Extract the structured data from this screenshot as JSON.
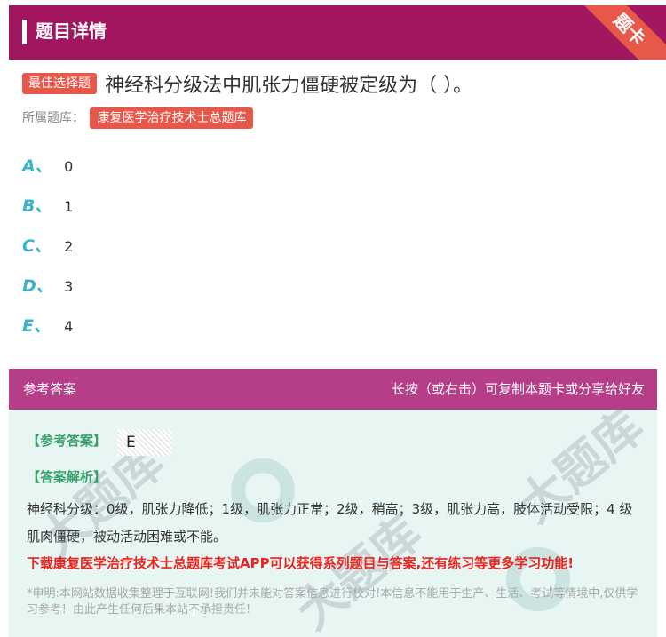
{
  "header": {
    "title": "题目详情",
    "corner_label": "题卡"
  },
  "question": {
    "type_label": "最佳选择题",
    "text": "神经科分级法中肌张力僵硬被定级为（ ）。",
    "bank_label": "所属题库：",
    "bank_name": "康复医学治疗技术士总题库"
  },
  "options": [
    {
      "letter": "A、",
      "text": "0"
    },
    {
      "letter": "B、",
      "text": "1"
    },
    {
      "letter": "C、",
      "text": "2"
    },
    {
      "letter": "D、",
      "text": "3"
    },
    {
      "letter": "E、",
      "text": "4"
    }
  ],
  "answer": {
    "head_left": "参考答案",
    "head_right": "长按（或右击）可复制本题卡或分享给好友",
    "ref_label": "【参考答案】",
    "ref_value": "E",
    "analysis_label": "【答案解析】",
    "analysis_text": "神经科分级：0级，肌张力降低；1级，肌张力正常；2级，稍高；3级，肌张力高，肢体活动受限；4 级肌肉僵硬，被动活动困难或不能。",
    "promo": "下载康复医学治疗技术士总题库考试APP可以获得系列题目与答案,还有练习等更多学习功能!",
    "disclaimer": "*申明:本网站数据收集整理于互联网!我们并未能对答案信息进行校对!本信息不能用于生产、生活、考试等情境中,仅供学习参考！由此产生任何后果本站不承担责任!"
  },
  "colors": {
    "brand": "#a0175f",
    "accent": "#e8584a",
    "option_letter": "#3ab4c8",
    "answer_green": "#3aa16a",
    "promo_red": "#e8251e"
  }
}
